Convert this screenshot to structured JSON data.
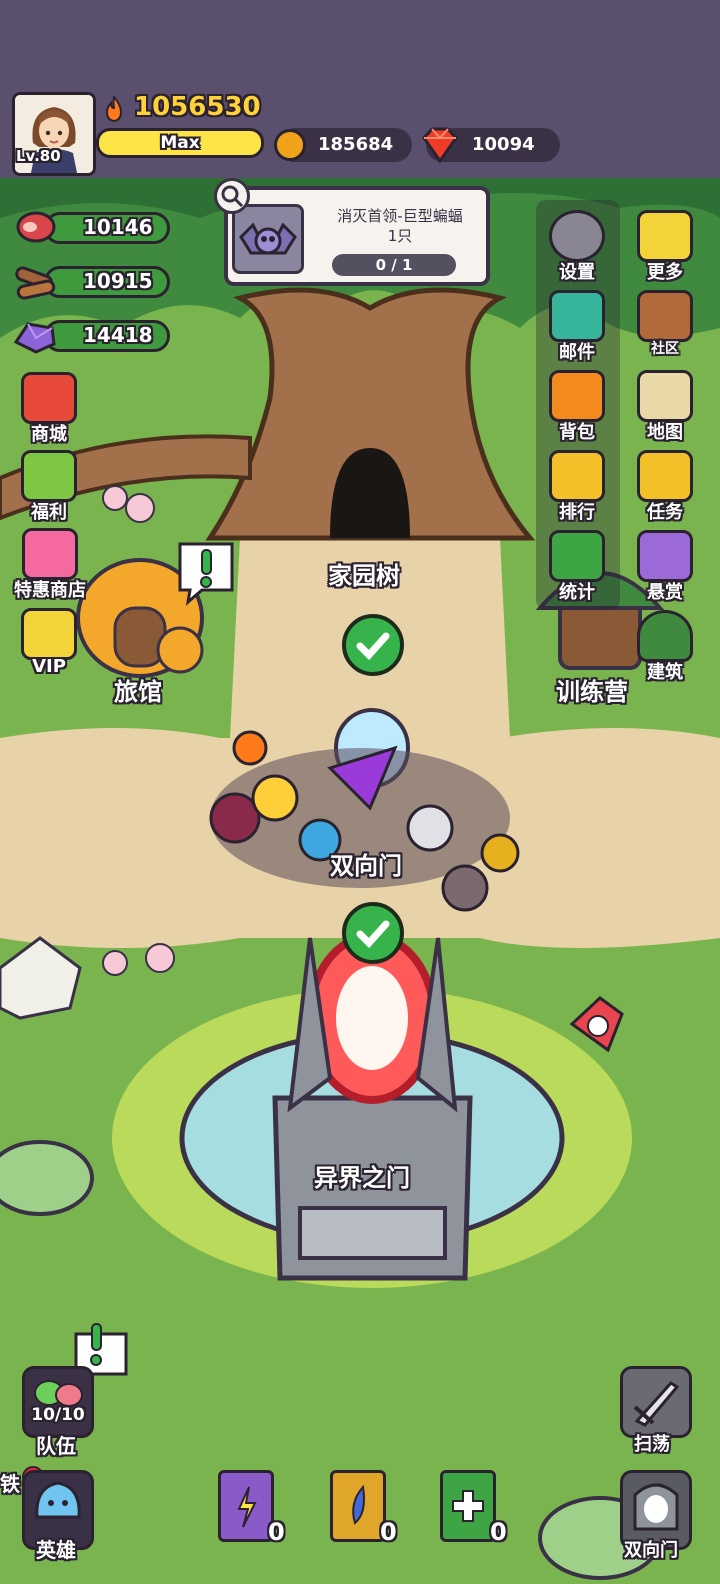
{
  "player": {
    "level": "Lv.80",
    "power": "1056530",
    "name": "Max"
  },
  "currencies": {
    "gold": "185684",
    "gems": "10094"
  },
  "resources": {
    "meat": "10146",
    "wood": "10915",
    "ore": "14418"
  },
  "quest": {
    "title": "消灭首领-巨型蝙蝠",
    "count": "1只",
    "progress": "0 / 1",
    "progress_fraction": 0
  },
  "left_menu": [
    {
      "label": "商城",
      "icon": "shop-icon"
    },
    {
      "label": "福利",
      "icon": "gift-icon"
    },
    {
      "label": "特惠商店",
      "icon": "special-shop-icon"
    },
    {
      "label": "VIP",
      "icon": "vip-icon"
    }
  ],
  "right_menu": [
    {
      "label": "设置",
      "icon": "gear-icon"
    },
    {
      "label": "更多",
      "icon": "more-icon"
    },
    {
      "label": "邮件",
      "icon": "mail-icon"
    },
    {
      "label": "社区",
      "icon": "community-icon"
    },
    {
      "label": "背包",
      "icon": "backpack-icon"
    },
    {
      "label": "地图",
      "icon": "map-icon"
    },
    {
      "label": "排行",
      "icon": "trophy-icon"
    },
    {
      "label": "任务",
      "icon": "task-icon"
    },
    {
      "label": "统计",
      "icon": "stats-icon"
    },
    {
      "label": "悬赏",
      "icon": "bounty-icon"
    },
    {
      "label": "建筑",
      "icon": "building-icon"
    }
  ],
  "places": {
    "home_tree": "家园树",
    "inn": "旅馆",
    "training_camp": "训练营",
    "two_way_gate": "双向门",
    "otherworld_gate": "异界之门"
  },
  "bottom": {
    "team_count": "10/10",
    "team_label": "队伍",
    "hero_label": "英雄",
    "partial_label": "铁",
    "sweep_label": "扫荡",
    "gate_label": "双向门",
    "books": [
      {
        "icon": "purple-skill-book-icon",
        "count": "0"
      },
      {
        "icon": "gold-skill-book-icon",
        "count": "0"
      },
      {
        "icon": "green-heal-book-icon",
        "count": "0"
      }
    ]
  },
  "colors": {
    "top_bar": "#5a506e",
    "grass": "#79b44f",
    "path": "#e8d2a8",
    "resource_pill": "#3e9a3c",
    "accent_yellow": "#ffe448"
  }
}
